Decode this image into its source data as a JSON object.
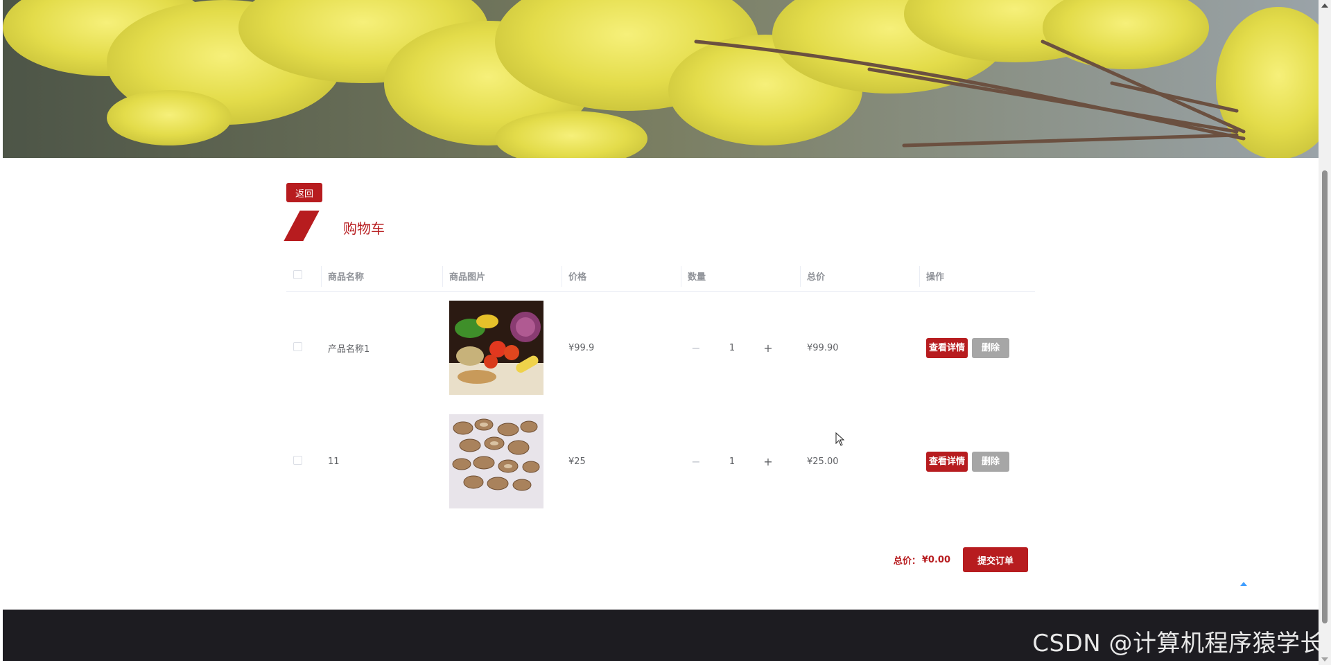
{
  "header": {
    "banner_icon": "yellow-flowers-banner"
  },
  "page": {
    "back_label": "返回",
    "title": "购物车"
  },
  "table": {
    "columns": [
      "商品名称",
      "商品图片",
      "价格",
      "数量",
      "总价",
      "操作"
    ],
    "rows": [
      {
        "name": "产品名称1",
        "image_icon": "vegetables-photo",
        "price": "¥99.9",
        "quantity": "1",
        "total": "¥99.90",
        "detail_label": "查看详情",
        "delete_label": "删除"
      },
      {
        "name": "11",
        "image_icon": "dried-herb-slices-photo",
        "price": "¥25",
        "quantity": "1",
        "total": "¥25.00",
        "detail_label": "查看详情",
        "delete_label": "删除"
      }
    ],
    "minus_symbol": "−",
    "plus_symbol": "+"
  },
  "summary": {
    "total_label": "总价：",
    "total_value": "¥0.00",
    "submit_label": "提交订单"
  },
  "footer": {
    "watermark": "CSDN @计算机程序猿学长"
  },
  "colors": {
    "accent": "#b71c1f",
    "delete_gray": "#a6a6a6",
    "footer_bg": "#1d1c21"
  }
}
